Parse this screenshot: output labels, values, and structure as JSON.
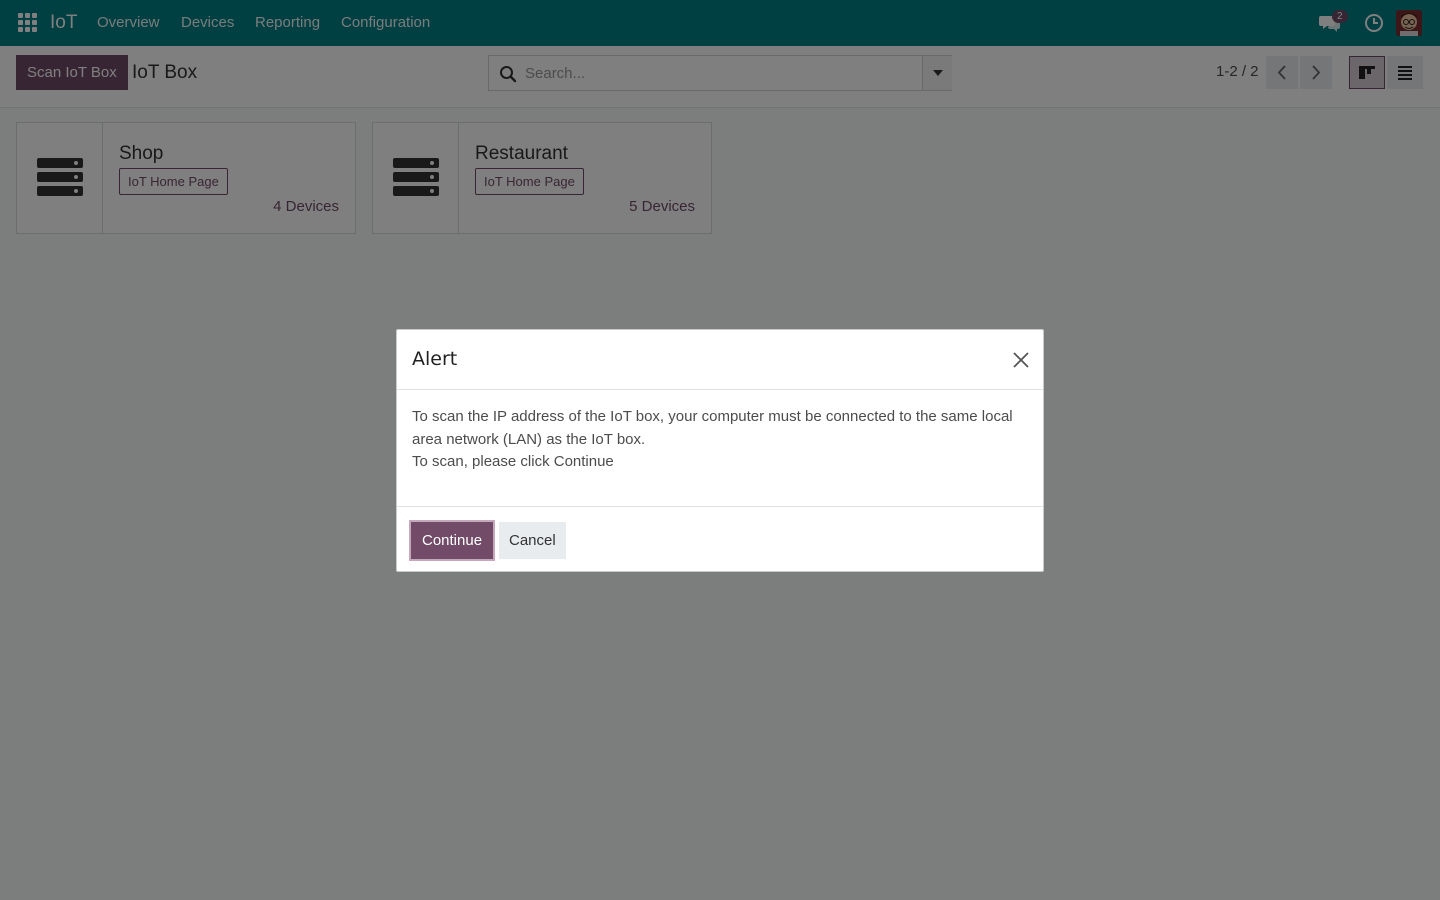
{
  "navbar": {
    "app_name": "IoT",
    "menu": [
      "Overview",
      "Devices",
      "Reporting",
      "Configuration"
    ],
    "chat_count": "2"
  },
  "control_panel": {
    "scan_button": "Scan IoT Box",
    "breadcrumb": "IoT Box",
    "search_placeholder": "Search...",
    "pager": "1-2 / 2"
  },
  "cards": [
    {
      "title": "Shop",
      "home_button": "IoT Home Page",
      "devices": "4 Devices"
    },
    {
      "title": "Restaurant",
      "home_button": "IoT Home Page",
      "devices": "5 Devices"
    }
  ],
  "dialog": {
    "title": "Alert",
    "body_line1": "To scan the IP address of the IoT box, your computer must be connected to the same local area network (LAN) as the IoT box.",
    "body_line2": "To scan, please click Continue",
    "continue_button": "Continue",
    "cancel_button": "Cancel"
  },
  "colors": {
    "navbar": "#017e84",
    "primary": "#714b67"
  }
}
